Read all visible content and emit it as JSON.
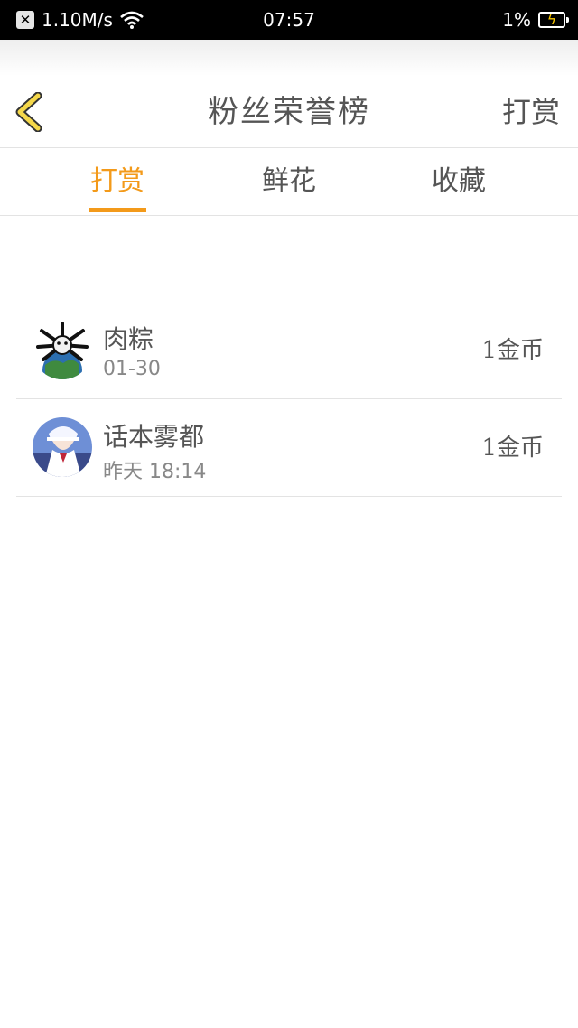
{
  "status_bar": {
    "net_speed": "1.10M/s",
    "time": "07:57",
    "battery": "1%"
  },
  "header": {
    "title": "粉丝荣誉榜",
    "action_label": "打赏",
    "back_icon": "chevron-left-icon"
  },
  "tabs": [
    {
      "label": "打赏",
      "active": true
    },
    {
      "label": "鲜花",
      "active": false
    },
    {
      "label": "收藏",
      "active": false
    }
  ],
  "list": [
    {
      "name": "肉粽",
      "date": "01-30",
      "amount": "1金币"
    },
    {
      "name": "话本雾都",
      "date_prefix": "昨天",
      "date": "18:14",
      "amount": "1金币"
    }
  ],
  "colors": {
    "accent": "#f39a1a",
    "back_icon_fill": "#f5d84a"
  }
}
